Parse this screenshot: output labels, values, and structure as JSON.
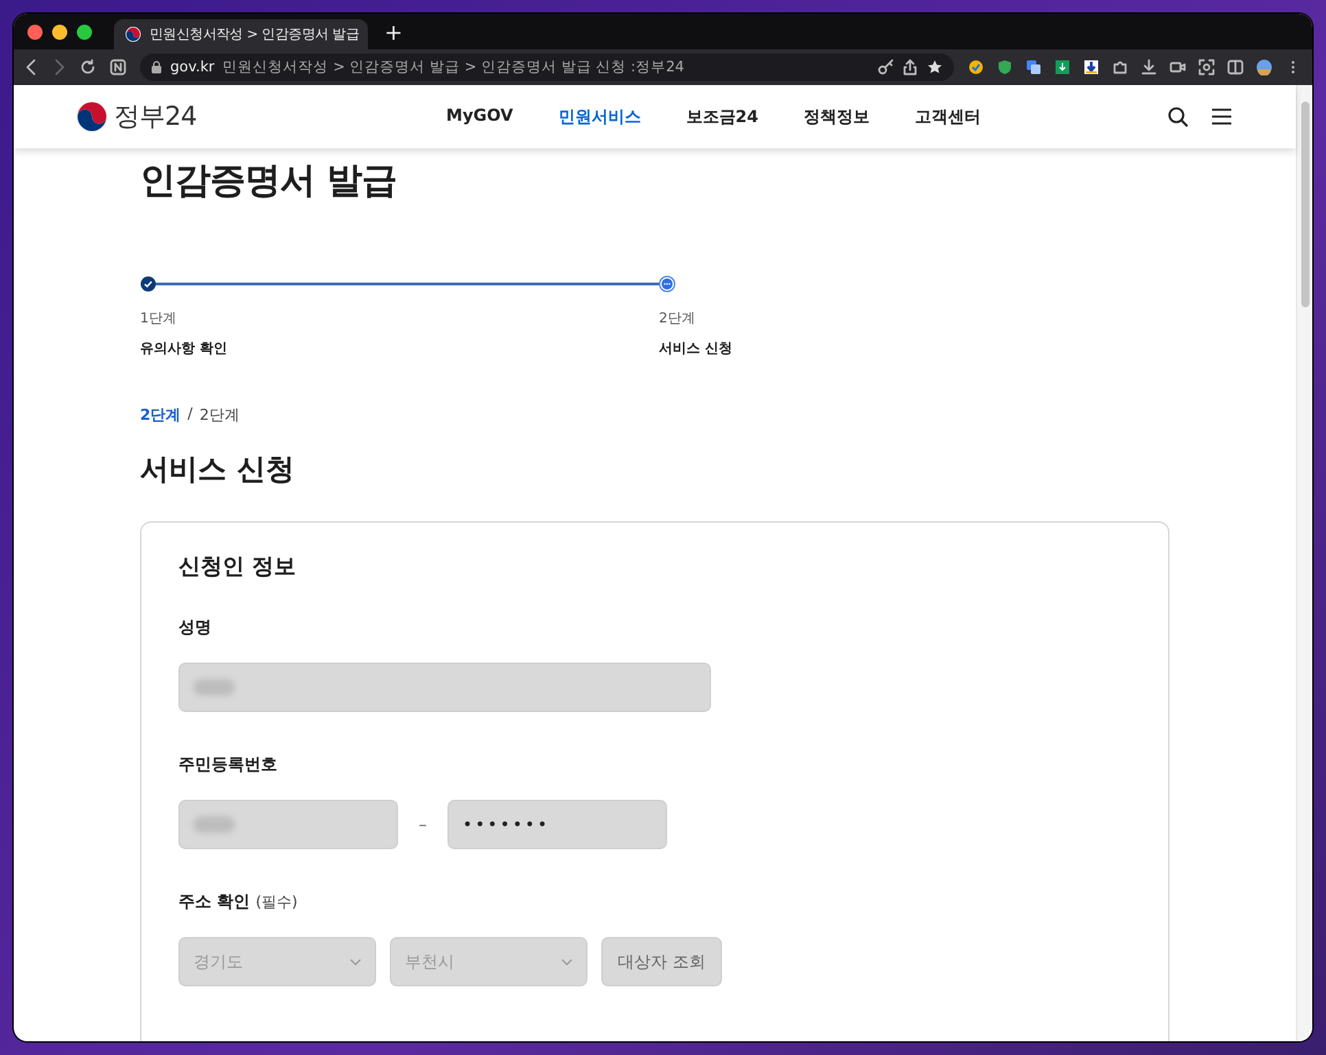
{
  "browser": {
    "tab": {
      "title": "민원신청서작성 > 인감증명서 발급",
      "selected": true
    },
    "new_tab": "+",
    "address": {
      "domain": "gov.kr",
      "path": "민원신청서작성 > 인감증명서 발급 > 인감증명서 발급 신청 :정부24"
    }
  },
  "site": {
    "logo": "정부24",
    "nav": [
      {
        "label": "MyGOV",
        "selected": false
      },
      {
        "label": "민원서비스",
        "selected": true
      },
      {
        "label": "보조금24",
        "selected": false
      },
      {
        "label": "정책정보",
        "selected": false
      },
      {
        "label": "고객센터",
        "selected": false
      }
    ]
  },
  "page_title": "인감증명서 발급",
  "steps": [
    {
      "kind": "done",
      "number": "1단계",
      "label": "유의사항 확인"
    },
    {
      "kind": "current",
      "number": "2단계",
      "label": "서비스 신청"
    }
  ],
  "progress": {
    "current": "2단계",
    "separator": "/",
    "total": "2단계"
  },
  "section_title": "서비스 신청",
  "form": {
    "title": "신청인 정보",
    "fields": [
      {
        "kind": "name",
        "label": "성명",
        "blurred": true
      },
      {
        "kind": "rrn",
        "label": "주민등록번호",
        "blurred": true,
        "dash": "–",
        "masked": "•••••••"
      },
      {
        "kind": "address",
        "label": "주소 확인",
        "note": "(필수)",
        "selects": [
          "경기도",
          "부천시"
        ],
        "button": "대상자 조회"
      }
    ]
  }
}
